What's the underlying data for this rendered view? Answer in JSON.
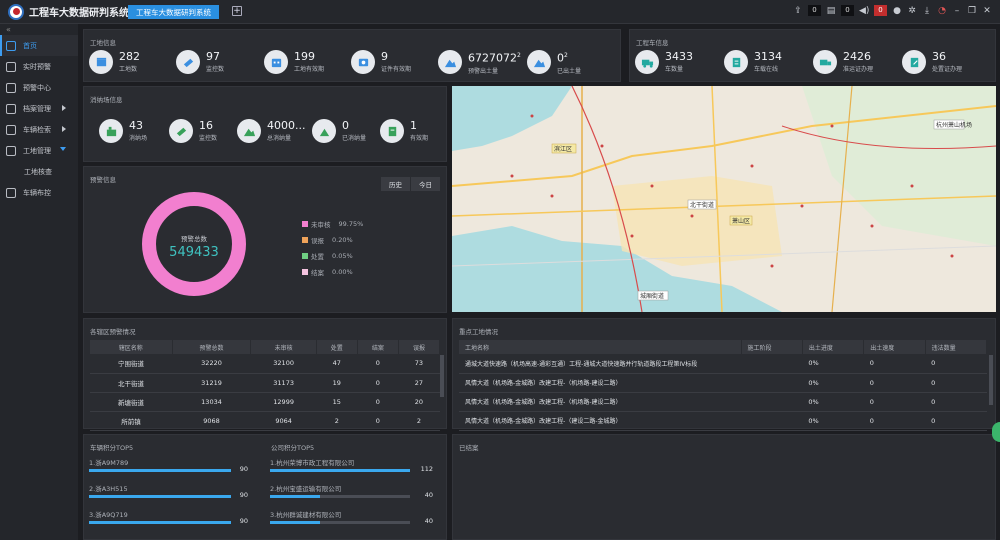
{
  "app": {
    "title": "工程车大数据研判系统",
    "tab": "工程车大数据研判系统"
  },
  "toolbar": {
    "c1": "0",
    "c2": "0",
    "c3": "0"
  },
  "sidebar": {
    "items": [
      {
        "label": "首页"
      },
      {
        "label": "实时预警"
      },
      {
        "label": "预警中心"
      },
      {
        "label": "档案管理"
      },
      {
        "label": "车辆检索"
      },
      {
        "label": "工地管理"
      },
      {
        "label": "工地核查"
      },
      {
        "label": "车辆布控"
      }
    ]
  },
  "site": {
    "title": "工地信息",
    "stats": [
      {
        "value": "282",
        "label": "工地数"
      },
      {
        "value": "97",
        "label": "监控数"
      },
      {
        "value": "199",
        "label": "工地有效期"
      },
      {
        "value": "9",
        "label": "证件有效期"
      },
      {
        "value": "6727072",
        "sup": "2",
        "label": "预警出土量"
      },
      {
        "value": "0",
        "sup": "2",
        "label": "已出土量"
      }
    ]
  },
  "vehicle": {
    "title": "工程车信息",
    "stats": [
      {
        "value": "3433",
        "label": "车数量"
      },
      {
        "value": "3134",
        "label": "车载在线"
      },
      {
        "value": "2426",
        "label": "准运证办理"
      },
      {
        "value": "36",
        "label": "处置证办理"
      }
    ]
  },
  "disposal": {
    "title": "消纳场信息",
    "stats": [
      {
        "value": "43",
        "label": "消纳场"
      },
      {
        "value": "16",
        "label": "监控数"
      },
      {
        "value": "4000...",
        "label": "总消纳量"
      },
      {
        "value": "0",
        "label": "已消纳量"
      },
      {
        "value": "1",
        "label": "有效期"
      }
    ]
  },
  "alarm": {
    "title": "预警信息",
    "btn_history": "历史",
    "btn_today": "今日",
    "center_label": "预警总数",
    "total": "549433",
    "legend": [
      {
        "name": "未审核",
        "pct": "99.75%",
        "color": "#f27fcf"
      },
      {
        "name": "误报",
        "pct": "0.20%",
        "color": "#f0a35a"
      },
      {
        "name": "处置",
        "pct": "0.05%",
        "color": "#6fcf83"
      },
      {
        "name": "结案",
        "pct": "0.00%",
        "color": "#f4c3df"
      }
    ]
  },
  "street": {
    "title": "各辖区预警情况",
    "headers": [
      "辖区名称",
      "预警总数",
      "未审核",
      "处置",
      "结案",
      "误报"
    ],
    "rows": [
      [
        "宁围街道",
        "32220",
        "32100",
        "47",
        "0",
        "73"
      ],
      [
        "北干街道",
        "31219",
        "31173",
        "19",
        "0",
        "27"
      ],
      [
        "新塘街道",
        "13034",
        "12999",
        "15",
        "0",
        "20"
      ],
      [
        "所前镇",
        "9068",
        "9064",
        "2",
        "0",
        "2"
      ]
    ]
  },
  "keysite": {
    "title": "重点工地情况",
    "headers": [
      "工地名称",
      "施工阶段",
      "出土进度",
      "出土速度",
      "违法数量"
    ],
    "rows": [
      [
        "通城大道快速路（机场高速-通彩互通）工程-通城大道快速路并行轨道路段工程第IV标段",
        "",
        "0%",
        "0",
        "0"
      ],
      [
        "风情大道（机场路-金城路）改建工程-（机场路-建设二路）",
        "",
        "0%",
        "0",
        "0"
      ],
      [
        "风情大道（机场路-金城路）改建工程-（机场路-建设二路）",
        "",
        "0%",
        "0",
        "0"
      ],
      [
        "风情大道（机场路-金城路）改建工程-（建设二路-金城路）",
        "",
        "0%",
        "0",
        "0"
      ]
    ]
  },
  "vehtop": {
    "title": "车辆积分TOP5",
    "rows": [
      {
        "name": "1.浙A9M789",
        "value": 90,
        "display": "90"
      },
      {
        "name": "2.浙A3H515",
        "value": 90,
        "display": "90"
      },
      {
        "name": "3.浙A9Q719",
        "value": 90,
        "display": "90"
      },
      {
        "name": "4.浙A5Y395",
        "value": 90,
        "display": "90"
      }
    ]
  },
  "comptop": {
    "title": "公司积分TOP5",
    "rows": [
      {
        "name": "1.杭州荣博市政工程有限公司",
        "value": 112,
        "display": "112"
      },
      {
        "name": "2.杭州宝盛运输有限公司",
        "value": 40,
        "display": "40"
      },
      {
        "name": "3.杭州群诚建材有限公司",
        "value": 40,
        "display": "40"
      },
      {
        "name": "4.杭州某某建设有限公司",
        "value": 40,
        "display": "40"
      }
    ]
  },
  "closed": {
    "title": "已结案"
  },
  "map": {
    "labels": [
      "滨江区",
      "北干街道",
      "萧山区",
      "城厢街道",
      "杭州萧山机场",
      "钱塘江",
      "建华路",
      "杭州湾"
    ]
  }
}
